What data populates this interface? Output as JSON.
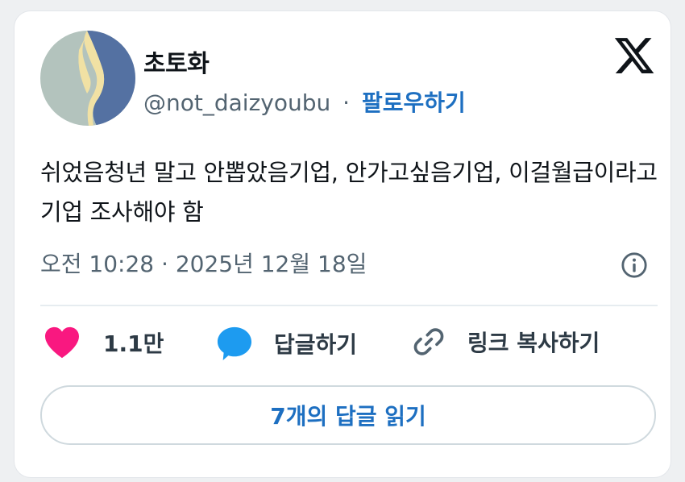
{
  "user": {
    "display_name": "초토화",
    "handle": "@not_daizyoubu",
    "separator": "·",
    "follow_label": "팔로우하기"
  },
  "platform_icon": "x-logo-icon",
  "tweet": {
    "text": "쉬었음청년 말고 안뽑았음기업, 안가고싶음기업, 이걸월급이라고기업 조사해야 함",
    "timestamp": "오전 10:28 · 2025년 12월 18일"
  },
  "actions": {
    "like_count": "1.1만",
    "reply_label": "답글하기",
    "copy_link_label": "링크 복사하기"
  },
  "read_replies_label": "7개의 답글 읽기",
  "colors": {
    "accent": "#1d6fc1",
    "like": "#f91880",
    "reply": "#1d9bf0",
    "text": "#0f1419",
    "muted": "#536471"
  }
}
